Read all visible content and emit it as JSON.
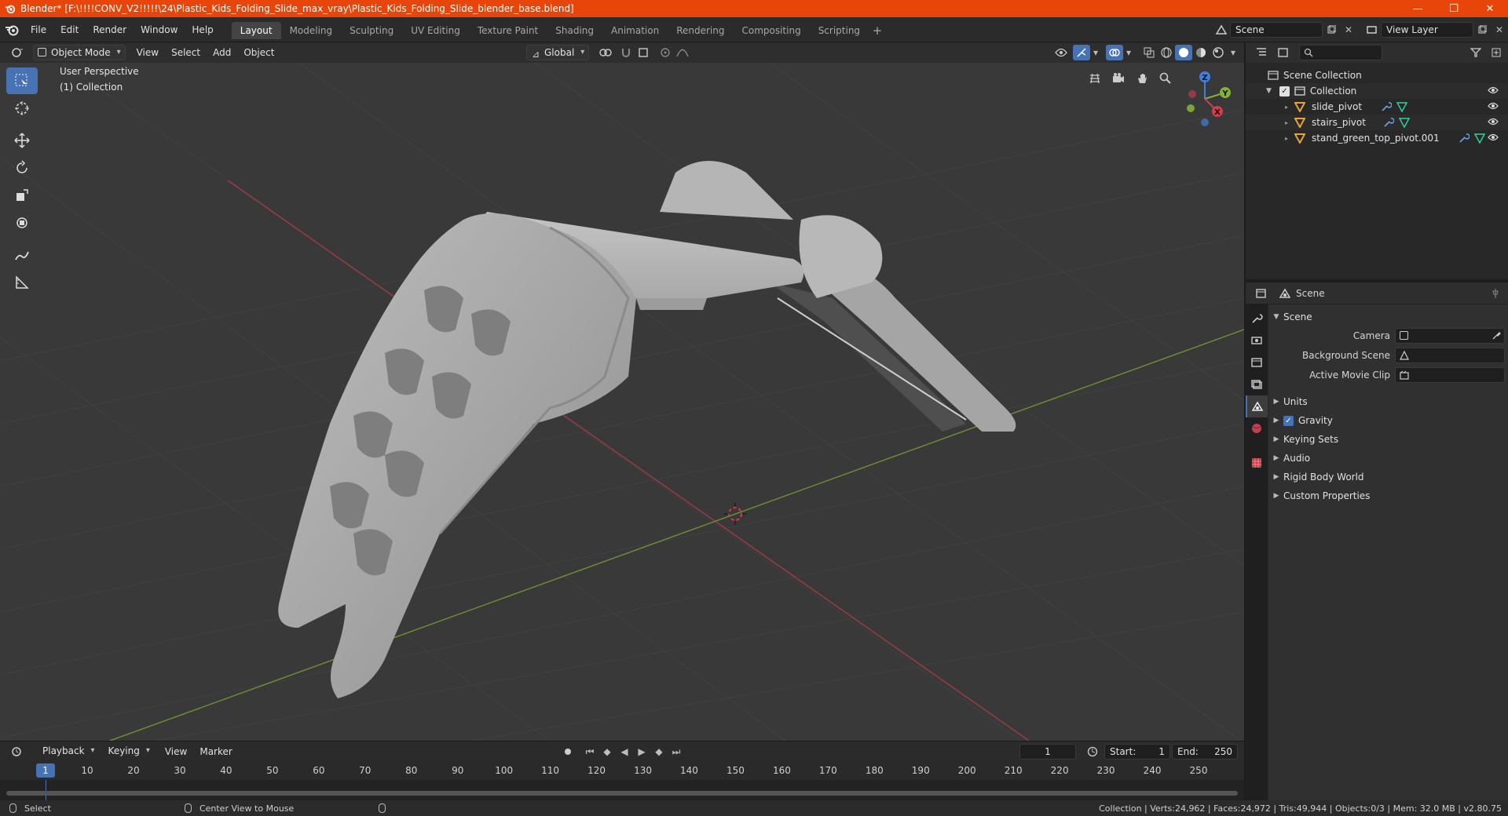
{
  "window": {
    "title": "Blender* [F:\\!!!!CONV_V2!!!!!\\24\\Plastic_Kids_Folding_Slide_max_vray\\Plastic_Kids_Folding_Slide_blender_base.blend]",
    "minimize": "—",
    "maximize": "❐",
    "close": "✕"
  },
  "menus": [
    "File",
    "Edit",
    "Render",
    "Window",
    "Help"
  ],
  "workspaces": [
    "Layout",
    "Modeling",
    "Sculpting",
    "UV Editing",
    "Texture Paint",
    "Shading",
    "Animation",
    "Rendering",
    "Compositing",
    "Scripting"
  ],
  "workspace_add": "+",
  "scene_selector": {
    "value": "Scene"
  },
  "view_layer_selector": {
    "value": "View Layer"
  },
  "viewport_header": {
    "mode": "Object Mode",
    "menus": [
      "View",
      "Select",
      "Add",
      "Object"
    ],
    "orientation": "Global"
  },
  "viewport": {
    "perspective_label": "User Perspective",
    "collection_label": "(1) Collection",
    "gizmo": {
      "x": "X",
      "y": "Y",
      "z": "Z"
    }
  },
  "outliner": {
    "search_placeholder": "",
    "scene_collection": "Scene Collection",
    "collection": "Collection",
    "items": [
      "slide_pivot",
      "stairs_pivot",
      "stand_green_top_pivot.001"
    ]
  },
  "properties": {
    "context": "Scene",
    "section": "Scene",
    "fields": [
      {
        "label": "Camera",
        "value": ""
      },
      {
        "label": "Background Scene",
        "value": ""
      },
      {
        "label": "Active Movie Clip",
        "value": ""
      }
    ],
    "panels": [
      "Units",
      "Gravity",
      "Keying Sets",
      "Audio",
      "Rigid Body World",
      "Custom Properties"
    ],
    "gravity_checked": true
  },
  "timeline": {
    "menus": [
      "Playback",
      "Keying",
      "View",
      "Marker"
    ],
    "current_frame": "1",
    "start_label": "Start:",
    "start": "1",
    "end_label": "End:",
    "end": "250",
    "ticks": [
      "1",
      "10",
      "20",
      "30",
      "40",
      "50",
      "60",
      "70",
      "80",
      "90",
      "100",
      "110",
      "120",
      "130",
      "140",
      "150",
      "160",
      "170",
      "180",
      "190",
      "200",
      "210",
      "220",
      "230",
      "240",
      "250"
    ]
  },
  "statusbar": {
    "left_action": "Select",
    "middle_action": "Center View to Mouse",
    "stats": "Collection | Verts:24,962 | Faces:24,972 | Tris:49,944 | Objects:0/3 | Mem: 32.0 MB | v2.80.75"
  },
  "colors": {
    "titlebar": "#e8450a",
    "accent": "#4772b3",
    "viewport_bg": "#393939",
    "x_axis": "#d33c4c",
    "y_axis": "#85b03a",
    "z_axis": "#3f80dd",
    "object_orange": "#e8a33a"
  }
}
